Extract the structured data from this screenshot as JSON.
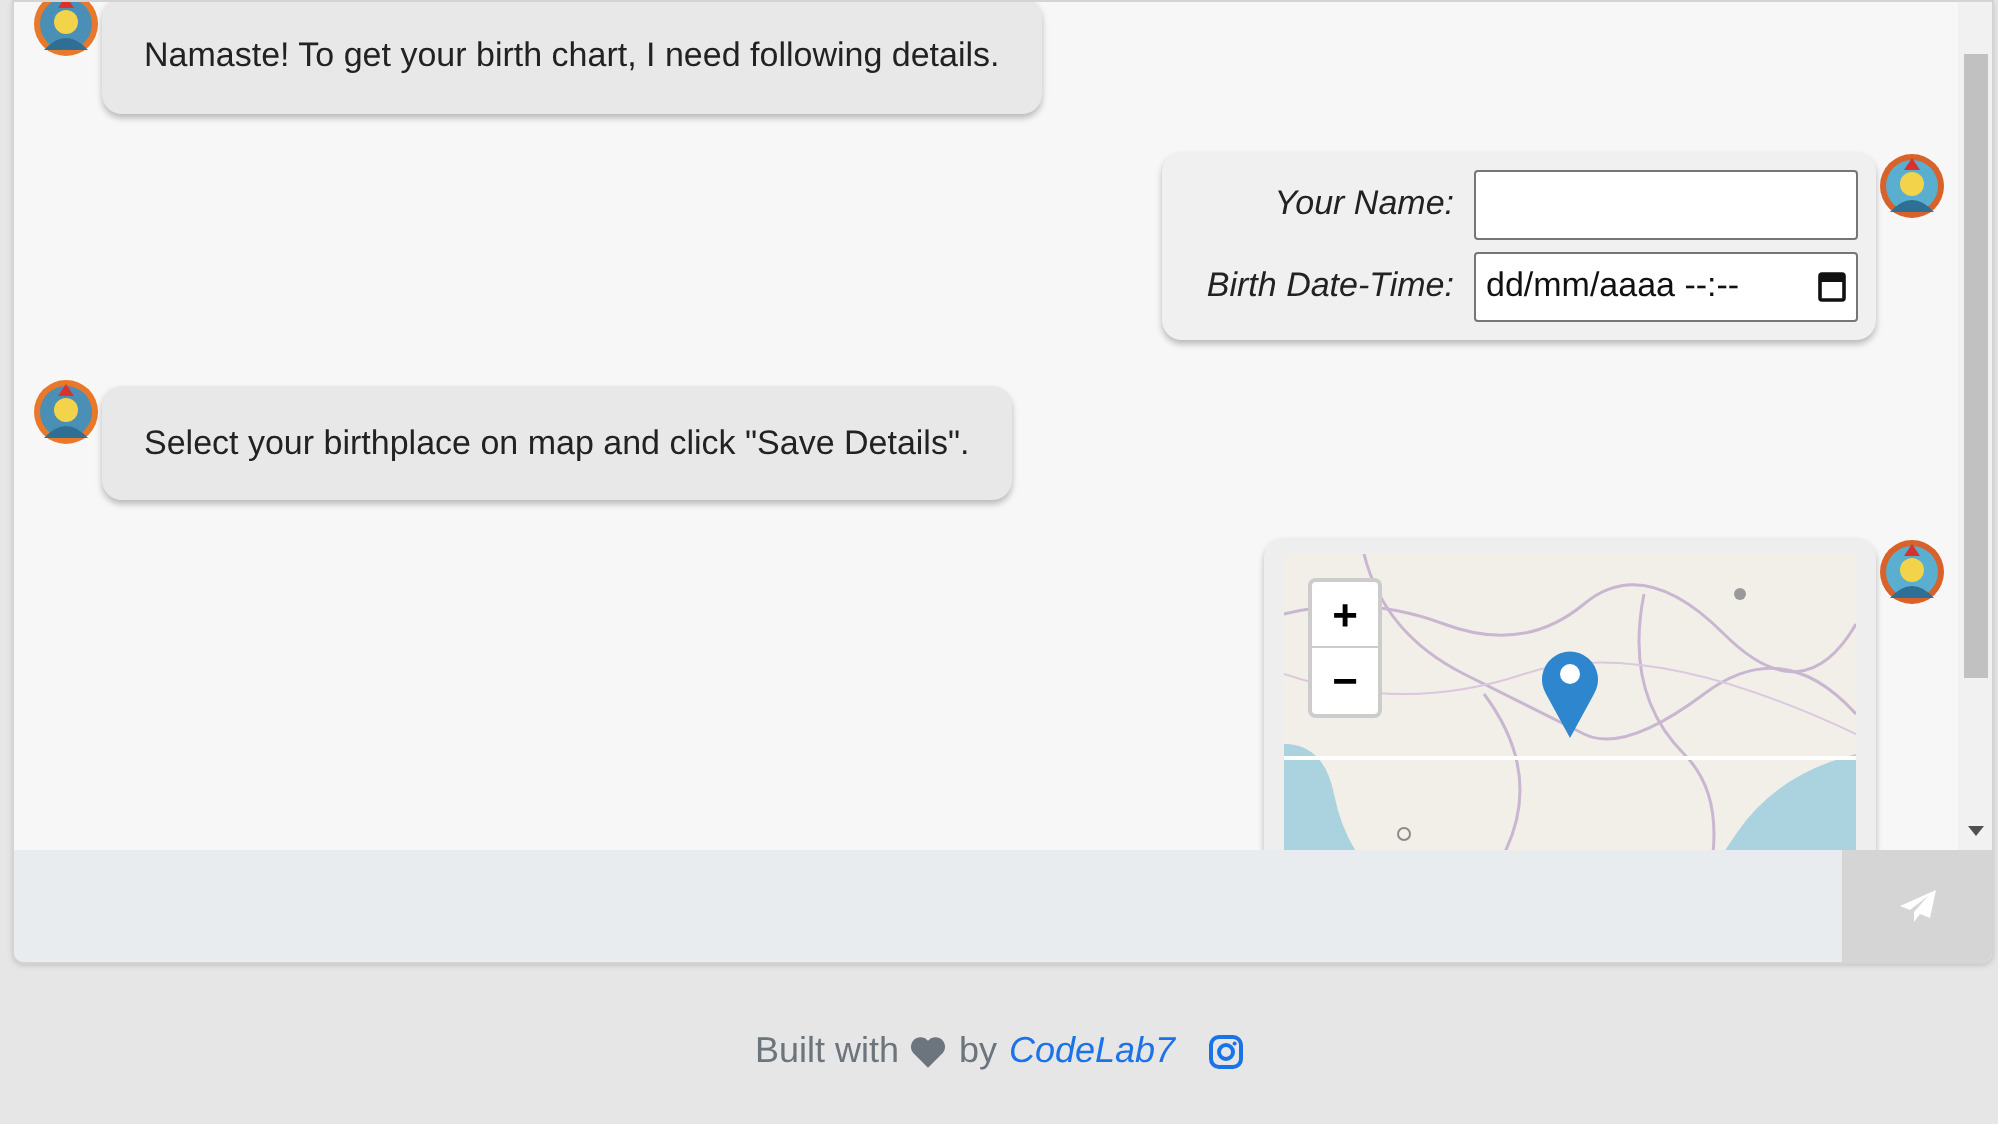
{
  "messages": [
    {
      "kind": "bot_text",
      "text": "Namaste! To get your birth chart, I need following details."
    },
    {
      "kind": "user_form",
      "fields": [
        {
          "label": "Your Name:",
          "kind": "text"
        },
        {
          "label": "Birth Date-Time:",
          "kind": "datetime",
          "placeholder": "dd/mm/aaaa --:--"
        }
      ]
    },
    {
      "kind": "bot_text",
      "text": "Select your birthplace on map and click \"Save Details\"."
    },
    {
      "kind": "user_map",
      "zoom_in": "+",
      "zoom_out": "−"
    }
  ],
  "footer": {
    "text_before": "Built with",
    "text_after": "by",
    "link": "CodeLab7"
  }
}
